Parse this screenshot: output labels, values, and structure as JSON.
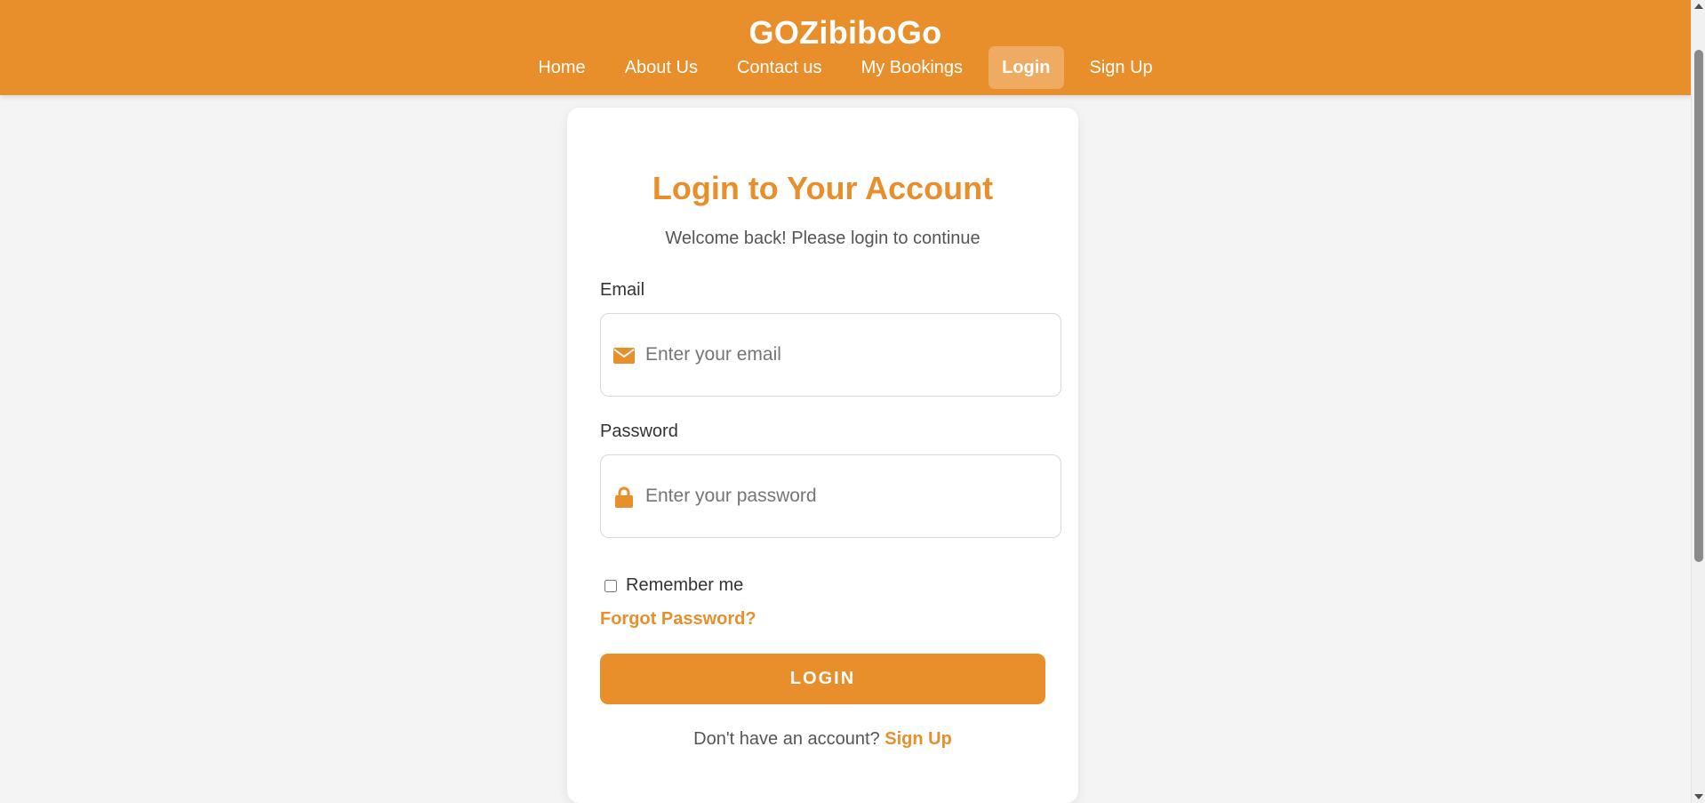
{
  "header": {
    "brand": "GOZibiboGo",
    "nav": [
      {
        "label": "Home",
        "active": false
      },
      {
        "label": "About Us",
        "active": false
      },
      {
        "label": "Contact us",
        "active": false
      },
      {
        "label": "My Bookings",
        "active": false
      },
      {
        "label": "Login",
        "active": true
      },
      {
        "label": "Sign Up",
        "active": false
      }
    ]
  },
  "login": {
    "title": "Login to Your Account",
    "subtitle": "Welcome back! Please login to continue",
    "email": {
      "label": "Email",
      "placeholder": "Enter your email",
      "value": "",
      "icon": "envelope-icon"
    },
    "password": {
      "label": "Password",
      "placeholder": "Enter your password",
      "value": "",
      "icon": "lock-icon"
    },
    "remember_label": "Remember me",
    "remember_checked": false,
    "forgot_label": "Forgot Password?",
    "submit_label": "LOGIN",
    "signup_prompt": "Don't have an account?",
    "signup_link": "Sign Up"
  },
  "colors": {
    "accent": "#e88f2c",
    "background": "#f4f4f4",
    "card": "#ffffff"
  }
}
